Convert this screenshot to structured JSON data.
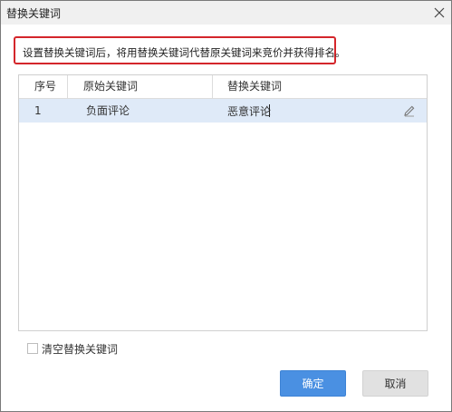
{
  "window": {
    "title": "替换关键词"
  },
  "notice": {
    "text": "设置替换关键词后，将用替换关键词代替原关键词来竞价并获得排名。"
  },
  "table": {
    "headers": [
      "序号",
      "原始关键词",
      "替换关键词"
    ],
    "rows": [
      {
        "index": "1",
        "original": "负面评论",
        "replacement": "恶意评论"
      }
    ]
  },
  "options": {
    "clear_label": "清空替换关键词"
  },
  "buttons": {
    "ok": "确定",
    "cancel": "取消"
  },
  "colors": {
    "accent": "#4a90e2",
    "notice_border": "#d4262b",
    "selected_row": "#dfeaf8"
  },
  "icons": {
    "close": "close-icon",
    "edit": "pencil-icon"
  }
}
